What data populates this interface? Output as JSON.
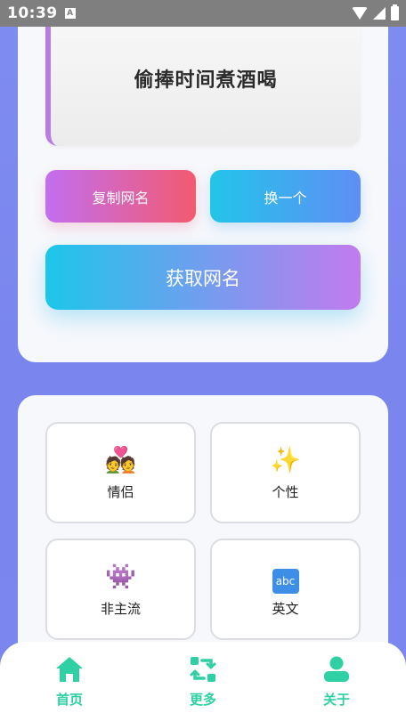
{
  "status_bar": {
    "time": "10:39",
    "indicator": "A"
  },
  "generator": {
    "name": "偷捧时间煮酒喝",
    "copy_label": "复制网名",
    "change_label": "换一个",
    "get_label": "获取网名"
  },
  "categories": [
    {
      "label": "情侣",
      "icon": "💑"
    },
    {
      "label": "个性",
      "icon": "✨"
    },
    {
      "label": "非主流",
      "icon": "👾"
    },
    {
      "label": "英文",
      "icon": "abc"
    }
  ],
  "nav": {
    "home_label": "首页",
    "more_label": "更多",
    "about_label": "关于"
  },
  "colors": {
    "accent_green": "#2ed0a4",
    "background": "#7f8cf0",
    "card": "#f7f8fc"
  }
}
